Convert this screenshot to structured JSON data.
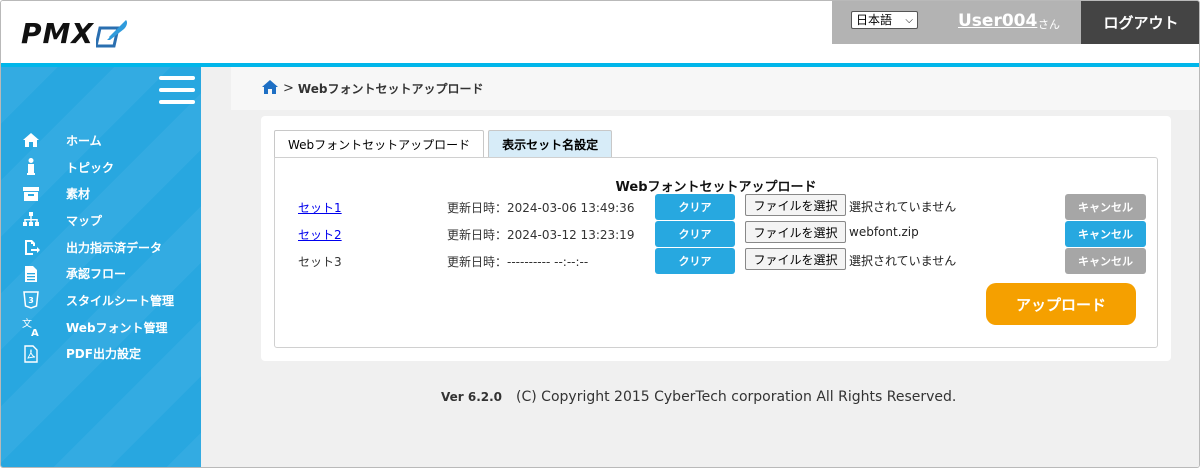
{
  "header": {
    "logo_text": "PMX",
    "language": "日本語",
    "user_name": "User004",
    "user_suffix": "さん",
    "logout_label": "ログアウト"
  },
  "sidebar": {
    "items": [
      {
        "label": "ホーム",
        "icon": "home-icon"
      },
      {
        "label": "トピック",
        "icon": "info-icon"
      },
      {
        "label": "素材",
        "icon": "archive-icon"
      },
      {
        "label": "マップ",
        "icon": "sitemap-icon"
      },
      {
        "label": "出力指示済データ",
        "icon": "export-icon"
      },
      {
        "label": "承認フロー",
        "icon": "document-icon"
      },
      {
        "label": "スタイルシート管理",
        "icon": "css3-icon"
      },
      {
        "label": "Webフォント管理",
        "icon": "translate-icon"
      },
      {
        "label": "PDF出力設定",
        "icon": "pdf-icon"
      }
    ]
  },
  "breadcrumb": {
    "separator": ">",
    "current": "Webフォントセットアップロード"
  },
  "tabs": [
    {
      "label": "Webフォントセットアップロード",
      "active": true
    },
    {
      "label": "表示セット名設定",
      "active": false
    }
  ],
  "upload_section": {
    "title": "Webフォントセットアップロード",
    "clear_label": "クリア",
    "choose_file_label": "ファイルを選択",
    "cancel_label": "キャンセル",
    "upload_label": "アップロード",
    "rows": [
      {
        "set_name": "セット1",
        "is_link": true,
        "updated": "更新日時：2024-03-06 13:49:36",
        "file_status": "選択されていません",
        "cancel_enabled": false
      },
      {
        "set_name": "セット2",
        "is_link": true,
        "updated": "更新日時：2024-03-12 13:23:19",
        "file_status": "webfont.zip",
        "cancel_enabled": true
      },
      {
        "set_name": "セット3",
        "is_link": false,
        "updated": "更新日時：---------- --:--:--",
        "file_status": "選択されていません",
        "cancel_enabled": false
      }
    ]
  },
  "footer": {
    "version": "Ver 6.2.0",
    "copyright": "(C) Copyright 2015 CyberTech corporation All Rights Reserved."
  },
  "colors": {
    "accent": "#27a8e0",
    "header_bar": "#00b6ea",
    "logout_bg": "#444444",
    "user_area_bg": "#b3b3b3",
    "upload_button": "#f5a000",
    "cancel_disabled": "#a6a6a6"
  }
}
